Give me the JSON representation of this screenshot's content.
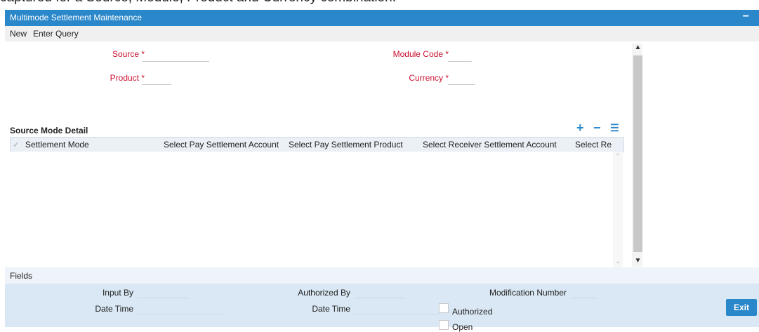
{
  "background_caption": "captured for a Source, Module, Product and Currency combination.",
  "window": {
    "title": "Multimode Settlement Maintenance",
    "minimize_glyph": "−"
  },
  "menu": {
    "items": [
      {
        "label": "New"
      },
      {
        "label": "Enter Query"
      }
    ]
  },
  "form": {
    "source": {
      "label": "Source *",
      "value": ""
    },
    "module_code": {
      "label": "Module Code *",
      "value": ""
    },
    "product": {
      "label": "Product *",
      "value": ""
    },
    "currency": {
      "label": "Currency *",
      "value": ""
    }
  },
  "source_mode_detail": {
    "title": "Source Mode Detail",
    "icons": [
      "add-row-icon",
      "delete-row-icon",
      "single-view-icon"
    ],
    "check_glyph": "✓",
    "columns": [
      "Settlement Mode",
      "Select Pay Settlement Account",
      "Select Pay Settlement Product",
      "Select Receiver Settlement Account",
      "Select Re"
    ],
    "rows": []
  },
  "fields_bar": {
    "label": "Fields"
  },
  "audit": {
    "input_by": "Input By",
    "date_time_1": "Date Time",
    "authorized_by": "Authorized By",
    "date_time_2": "Date Time",
    "modification_number": "Modification Number",
    "authorized": "Authorized",
    "open": "Open"
  },
  "actions": {
    "exit": "Exit"
  },
  "colors": {
    "accent": "#2a87c9",
    "required_label": "#c8102e",
    "footer_bg": "#d9e8f4"
  }
}
